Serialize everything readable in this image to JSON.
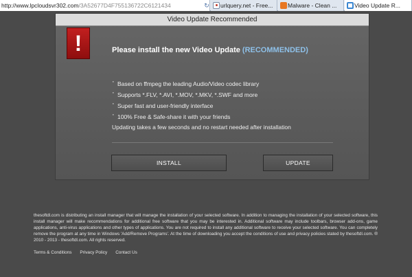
{
  "browser": {
    "address_host": "http://www.lpcloudsvr302.com",
    "address_path": "/3A52677D4F755136722C6121434",
    "tabs": [
      {
        "label": "urlquery.net - Free...",
        "icon": "pin-icon"
      },
      {
        "label": "Malware - Clean ...",
        "icon": "malware-site-icon"
      },
      {
        "label": "Video Update R...",
        "icon": "ie-icon"
      }
    ]
  },
  "modal": {
    "title": "Video Update Recommended",
    "alert_glyph": "!",
    "headline_main": "Please install the new Video Update ",
    "headline_badge": "(RECOMMENDED)",
    "features": [
      "Based on ffmpeg the leading Audio/Video codec library",
      "Supports *.FLV, *.AVI, *.MOV, *.MKV, *.SWF and more",
      "Super fast and user-friendly interface",
      "100% Free & Safe-share it with your friends"
    ],
    "note": "Updating takes a few seconds and no restart needed after installation",
    "install_label": "INSTALL",
    "update_label": "UPDATE"
  },
  "footer": {
    "disclaimer": "thesoftdl.com is distributing an install manager that will manage the installation of your selected software. In addition to managing the installation of your selected software, this install manager will make recommendations for additional free software that you may be interested in. Additional software may include toolbars, browser add-ons, game applications, anti-virus applications and other types of applications. You are not required to install any additional software to receive your selected software. You can completely remove the program at any time in Windows 'Add/Remove Programs'. At the time of downloading you accept the conditions of use and privacy policies stated by thesoftdl.com. ® 2010 - 2013 - thesoftdl.com. All rights reserved.",
    "links": [
      "Terms & Conditions",
      "Privacy Policy",
      "Contact Us"
    ]
  },
  "colors": {
    "page_background": "#4a4a4a",
    "modal_background": "#5e5e5e",
    "alert_red": "#b31515",
    "recommended_blue": "#8ec0e8"
  }
}
